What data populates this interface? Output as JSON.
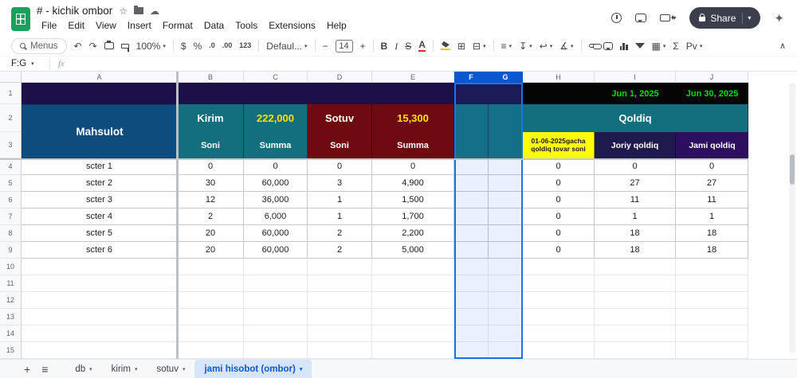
{
  "colors": {
    "band_purple": "#1d1048",
    "band_black": "#050505",
    "date_green": "#00dc00",
    "teal": "#136f7d",
    "dark_red": "#6e0b10",
    "accent_yellow": "#ffe100",
    "yellow_bg": "#ffff00",
    "mahsulot_blue": "#0e4c7e",
    "joriy_navy": "#1f1a4e",
    "jami_purple": "#2c0f5e",
    "selection_blue": "#1a73e8",
    "selected_header": "#0b57d0",
    "tab_active_bg": "#d7e5fb",
    "tab_active_fg": "#0b57d0"
  },
  "app": {
    "title": "# - kichik ombor",
    "menus": [
      "File",
      "Edit",
      "View",
      "Insert",
      "Format",
      "Data",
      "Tools",
      "Extensions",
      "Help"
    ],
    "share_label": "Share"
  },
  "icons": {
    "star": "☆",
    "cloud": "☁",
    "sparkle": "✦",
    "undo": "↶",
    "redo": "↷",
    "borders": "⊞",
    "merge": "⊟",
    "align": "≡",
    "valign": "↧",
    "wrap": "↩",
    "rotate": "∡",
    "views": "▦",
    "collapse": "∧",
    "all_sheets": "≡"
  },
  "toolbar": {
    "menus_label": "Menus",
    "zoom": "100%",
    "currency": "$",
    "percent": "%",
    "dec_dec": ".0",
    "dec_inc": ".00",
    "fmt_123": "123",
    "font_name": "Defaul...",
    "minus": "−",
    "font_size": "14",
    "plus": "+",
    "bold": "B",
    "italic": "I",
    "strike": "S",
    "text_color": "A",
    "sigma": "Σ",
    "pivot": "Pv"
  },
  "formula_bar": {
    "name_box": "F:G",
    "fx_label": "fx"
  },
  "grid": {
    "column_headers": [
      "A",
      "B",
      "C",
      "D",
      "E",
      "F",
      "G",
      "H",
      "I",
      "J"
    ],
    "selected_columns": [
      "F",
      "G"
    ],
    "frozen_row_numbers": [
      "1",
      "2",
      "3"
    ],
    "dates": {
      "start": "Jun 1, 2025",
      "end": "Jun 30, 2025"
    },
    "header": {
      "mahsulot": "Mahsulot",
      "kirim_label": "Kirim",
      "kirim_total": "222,000",
      "sotuv_label": "Sotuv",
      "sotuv_total": "15,300",
      "qoldiq_label": "Qoldiq",
      "soni": "Soni",
      "summa": "Summa",
      "qoldiq_tovar": "01-06-2025gacha qoldiq tovar soni",
      "joriy_qoldiq": "Joriy qoldiq",
      "jami_qoldiq": "Jami qoldiq"
    },
    "rows": [
      {
        "row": "4",
        "a": "scter 1",
        "b": "0",
        "c": "0",
        "d": "0",
        "e": "0",
        "f": "",
        "g": "",
        "h": "0",
        "i": "0",
        "j": "0"
      },
      {
        "row": "5",
        "a": "scter 2",
        "b": "30",
        "c": "60,000",
        "d": "3",
        "e": "4,900",
        "f": "",
        "g": "",
        "h": "0",
        "i": "27",
        "j": "27"
      },
      {
        "row": "6",
        "a": "scter 3",
        "b": "12",
        "c": "36,000",
        "d": "1",
        "e": "1,500",
        "f": "",
        "g": "",
        "h": "0",
        "i": "11",
        "j": "11"
      },
      {
        "row": "7",
        "a": "scter 4",
        "b": "2",
        "c": "6,000",
        "d": "1",
        "e": "1,700",
        "f": "",
        "g": "",
        "h": "0",
        "i": "1",
        "j": "1"
      },
      {
        "row": "8",
        "a": "scter 5",
        "b": "20",
        "c": "60,000",
        "d": "2",
        "e": "2,200",
        "f": "",
        "g": "",
        "h": "0",
        "i": "18",
        "j": "18"
      },
      {
        "row": "9",
        "a": "scter 6",
        "b": "20",
        "c": "60,000",
        "d": "2",
        "e": "5,000",
        "f": "",
        "g": "",
        "h": "0",
        "i": "18",
        "j": "18"
      }
    ],
    "empty_rows": [
      "10",
      "11",
      "12",
      "13",
      "14",
      "15"
    ]
  },
  "tabs": {
    "add": "+",
    "items": [
      {
        "label": "db",
        "active": false
      },
      {
        "label": "kirim",
        "active": false
      },
      {
        "label": "sotuv",
        "active": false
      },
      {
        "label": "jami hisobot (ombor)",
        "active": true
      }
    ]
  }
}
